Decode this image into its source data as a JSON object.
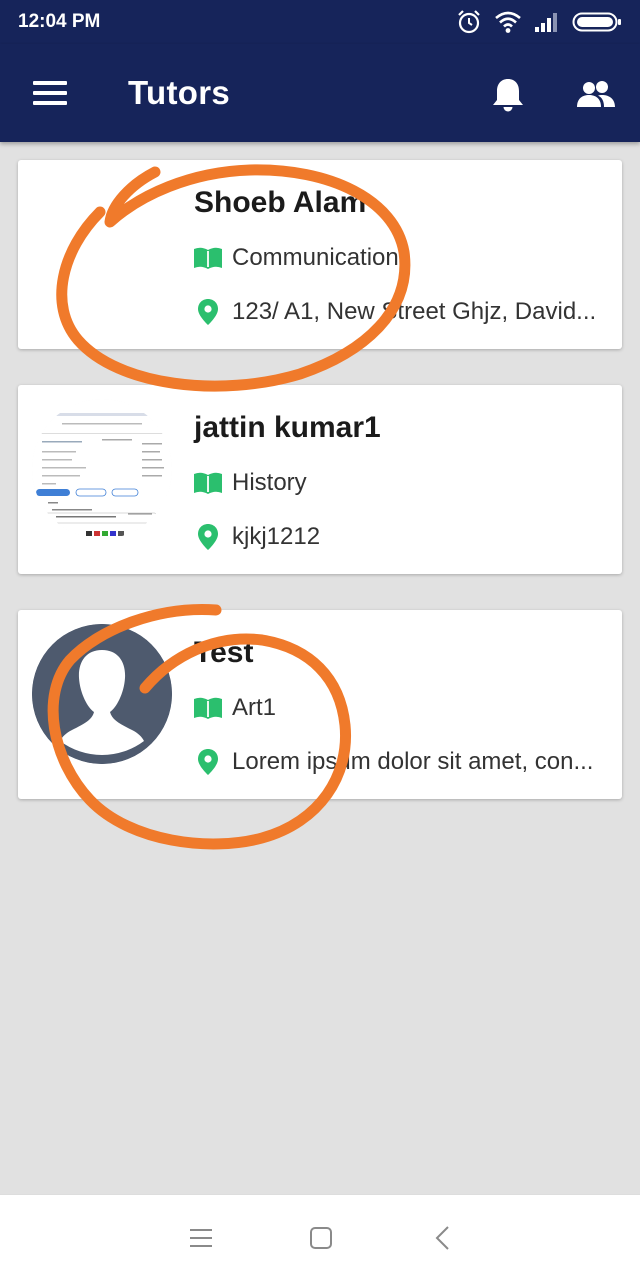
{
  "status_bar": {
    "time": "12:04 PM"
  },
  "app_bar": {
    "title": "Tutors"
  },
  "tutors": [
    {
      "name": "Shoeb Alam",
      "subject": "Communications",
      "address": "123/ A1, New Street Ghjz, David..."
    },
    {
      "name": "jattin kumar1",
      "subject": "History",
      "address": "kjkj1212"
    },
    {
      "name": "Test",
      "subject": "Art1",
      "address": "Lorem ipsum dolor sit amet, con..."
    }
  ],
  "colors": {
    "primary": "#16245a",
    "accent_icon": "#2bbf6e",
    "background": "#e1e1e1",
    "annotation": "#f07a2b",
    "avatar_bg": "#4e5a6e"
  },
  "icons": {
    "subject": "book-icon",
    "address": "location-pin-icon",
    "menu": "hamburger-menu-icon",
    "notifications": "bell-icon",
    "people": "people-icon"
  }
}
